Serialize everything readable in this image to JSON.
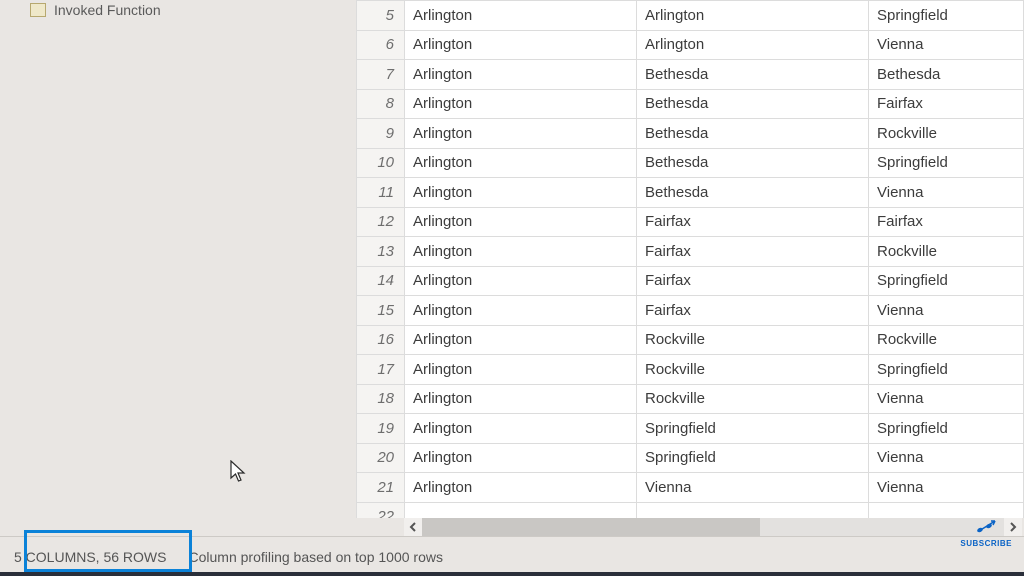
{
  "sidebar": {
    "item_label": "Invoked Function"
  },
  "grid": {
    "rows": [
      {
        "n": 5,
        "c1": "Arlington",
        "c2": "Arlington",
        "c3": "Springfield"
      },
      {
        "n": 6,
        "c1": "Arlington",
        "c2": "Arlington",
        "c3": "Vienna"
      },
      {
        "n": 7,
        "c1": "Arlington",
        "c2": "Bethesda",
        "c3": "Bethesda"
      },
      {
        "n": 8,
        "c1": "Arlington",
        "c2": "Bethesda",
        "c3": "Fairfax"
      },
      {
        "n": 9,
        "c1": "Arlington",
        "c2": "Bethesda",
        "c3": "Rockville"
      },
      {
        "n": 10,
        "c1": "Arlington",
        "c2": "Bethesda",
        "c3": "Springfield"
      },
      {
        "n": 11,
        "c1": "Arlington",
        "c2": "Bethesda",
        "c3": "Vienna"
      },
      {
        "n": 12,
        "c1": "Arlington",
        "c2": "Fairfax",
        "c3": "Fairfax"
      },
      {
        "n": 13,
        "c1": "Arlington",
        "c2": "Fairfax",
        "c3": "Rockville"
      },
      {
        "n": 14,
        "c1": "Arlington",
        "c2": "Fairfax",
        "c3": "Springfield"
      },
      {
        "n": 15,
        "c1": "Arlington",
        "c2": "Fairfax",
        "c3": "Vienna"
      },
      {
        "n": 16,
        "c1": "Arlington",
        "c2": "Rockville",
        "c3": "Rockville"
      },
      {
        "n": 17,
        "c1": "Arlington",
        "c2": "Rockville",
        "c3": "Springfield"
      },
      {
        "n": 18,
        "c1": "Arlington",
        "c2": "Rockville",
        "c3": "Vienna"
      },
      {
        "n": 19,
        "c1": "Arlington",
        "c2": "Springfield",
        "c3": "Springfield"
      },
      {
        "n": 20,
        "c1": "Arlington",
        "c2": "Springfield",
        "c3": "Vienna"
      },
      {
        "n": 21,
        "c1": "Arlington",
        "c2": "Vienna",
        "c3": "Vienna"
      },
      {
        "n": 22,
        "c1": "",
        "c2": "",
        "c3": ""
      }
    ]
  },
  "status": {
    "columns_rows": "5 COLUMNS, 56 ROWS",
    "profiling": "Column profiling based on top 1000 rows"
  },
  "subscribe": {
    "label": "SUBSCRIBE"
  }
}
